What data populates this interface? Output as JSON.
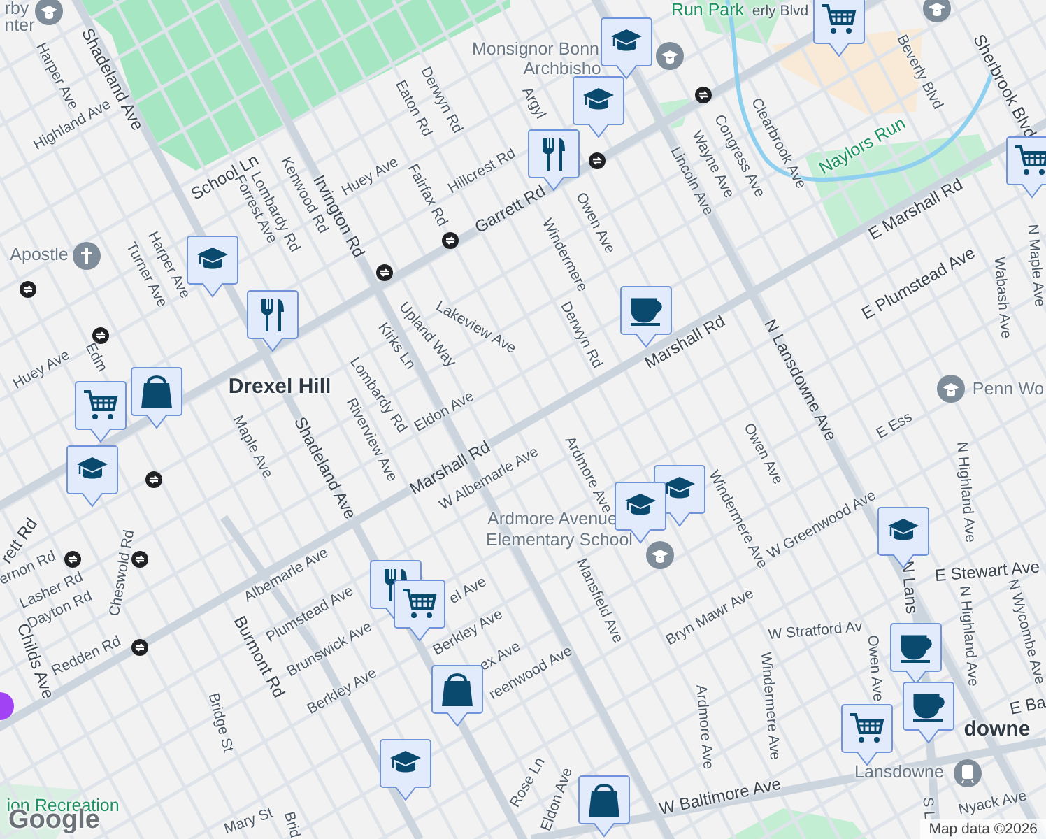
{
  "labels": [
    {
      "text": "rby",
      "kind": "poi"
    },
    {
      "text": "nter",
      "kind": "poi"
    },
    {
      "text": "Harper Ave",
      "kind": "street"
    },
    {
      "text": "Shadeland Ave",
      "kind": "major"
    },
    {
      "text": "Highland Ave",
      "kind": "street"
    },
    {
      "text": "Monsignor Bonn",
      "kind": "poi"
    },
    {
      "text": "Archbisho",
      "kind": "poi"
    },
    {
      "text": "Run Park",
      "kind": "park"
    },
    {
      "text": "erly Blvd",
      "kind": "street"
    },
    {
      "text": "Eaton Rd",
      "kind": "street"
    },
    {
      "text": "Derwyn Rd",
      "kind": "street"
    },
    {
      "text": "School Ln",
      "kind": "major"
    },
    {
      "text": "Forrest Ave",
      "kind": "street"
    },
    {
      "text": "Lombardy Rd",
      "kind": "street"
    },
    {
      "text": "Kenwood Rd",
      "kind": "street"
    },
    {
      "text": "Irvington Rd",
      "kind": "major"
    },
    {
      "text": "Huey Ave",
      "kind": "street"
    },
    {
      "text": "Fairfax Rd",
      "kind": "street"
    },
    {
      "text": "Hillcrest Rd",
      "kind": "street"
    },
    {
      "text": "Garrett Rd",
      "kind": "major"
    },
    {
      "text": "Argyl",
      "kind": "street"
    },
    {
      "text": "Owen Ave",
      "kind": "street"
    },
    {
      "text": "Windermere",
      "kind": "street"
    },
    {
      "text": "Lincoln Ave",
      "kind": "street"
    },
    {
      "text": "Wayne Ave",
      "kind": "street"
    },
    {
      "text": "Congress Ave",
      "kind": "street"
    },
    {
      "text": "Clearbrook Ave",
      "kind": "street"
    },
    {
      "text": "Beverly Blvd",
      "kind": "street"
    },
    {
      "text": "Sherbrook Blvd",
      "kind": "major"
    },
    {
      "text": "Naylors Run",
      "kind": "park"
    },
    {
      "text": "E Marshall Rd",
      "kind": "major"
    },
    {
      "text": "E Plumstead Ave",
      "kind": "major"
    },
    {
      "text": "Wabash Ave",
      "kind": "street"
    },
    {
      "text": "N Maple Ave",
      "kind": "street"
    },
    {
      "text": "Apostle",
      "kind": "poi"
    },
    {
      "text": "Turner Ave",
      "kind": "street"
    },
    {
      "text": "Harper Ave",
      "kind": "street"
    },
    {
      "text": "Lakeview Ave",
      "kind": "street"
    },
    {
      "text": "Upland Way",
      "kind": "street"
    },
    {
      "text": "Kirks Ln",
      "kind": "street"
    },
    {
      "text": "Lombardy Rd",
      "kind": "street"
    },
    {
      "text": "Eldon Ave",
      "kind": "street"
    },
    {
      "text": "Derwyn Rd",
      "kind": "street"
    },
    {
      "text": "Marshall Rd",
      "kind": "major"
    },
    {
      "text": "N Lansdowne Ave",
      "kind": "major"
    },
    {
      "text": "Penn Wo",
      "kind": "poi"
    },
    {
      "text": "Huey Ave",
      "kind": "street"
    },
    {
      "text": "Edm",
      "kind": "street"
    },
    {
      "text": "Drexel Hill",
      "kind": "place"
    },
    {
      "text": "Maple Ave",
      "kind": "street"
    },
    {
      "text": "Shadeland Ave",
      "kind": "major"
    },
    {
      "text": "Riverview Ave",
      "kind": "street"
    },
    {
      "text": "Marshall Rd",
      "kind": "major"
    },
    {
      "text": "W Albemarle Ave",
      "kind": "street"
    },
    {
      "text": "Ardmore Ave",
      "kind": "street"
    },
    {
      "text": "Owen Ave",
      "kind": "street"
    },
    {
      "text": "E Ess",
      "kind": "street"
    },
    {
      "text": "Ardmore Avenue",
      "kind": "poi"
    },
    {
      "text": "Elementary School",
      "kind": "poi"
    },
    {
      "text": "Windermere Ave",
      "kind": "street"
    },
    {
      "text": "W Greenwood Ave",
      "kind": "street"
    },
    {
      "text": "N Highland Ave",
      "kind": "street"
    },
    {
      "text": "E Stewart Ave",
      "kind": "major"
    },
    {
      "text": "N Lans",
      "kind": "major"
    },
    {
      "text": "N Wycombe Ave",
      "kind": "street"
    },
    {
      "text": "N Highland Ave",
      "kind": "street"
    },
    {
      "text": "Mansfield Ave",
      "kind": "street"
    },
    {
      "text": "Bryn Mawr Ave",
      "kind": "street"
    },
    {
      "text": "W Stratford Av",
      "kind": "street"
    },
    {
      "text": "Owen Ave",
      "kind": "street"
    },
    {
      "text": "Windermere Ave",
      "kind": "street"
    },
    {
      "text": "Ardmore Ave",
      "kind": "street"
    },
    {
      "text": "E Ba",
      "kind": "major"
    },
    {
      "text": "downe",
      "kind": "place"
    },
    {
      "text": "Lansdowne",
      "kind": "poi"
    },
    {
      "text": "W Baltimore Ave",
      "kind": "major"
    },
    {
      "text": "Nyack Ave",
      "kind": "street"
    },
    {
      "text": "S L",
      "kind": "street"
    },
    {
      "text": "Rose Ln",
      "kind": "street"
    },
    {
      "text": "Eldon Ave",
      "kind": "street"
    },
    {
      "text": "rett Rd",
      "kind": "major"
    },
    {
      "text": "ernon Rd",
      "kind": "street"
    },
    {
      "text": "Cheswold Rd",
      "kind": "street"
    },
    {
      "text": "Lasher Rd",
      "kind": "street"
    },
    {
      "text": "Dayton Rd",
      "kind": "street"
    },
    {
      "text": "Childs Ave",
      "kind": "major"
    },
    {
      "text": "Redden Rd",
      "kind": "street"
    },
    {
      "text": "Albemarle Ave",
      "kind": "street"
    },
    {
      "text": "Plumstead Ave",
      "kind": "street"
    },
    {
      "text": "Brunswick Ave",
      "kind": "street"
    },
    {
      "text": "Berkley Ave",
      "kind": "street"
    },
    {
      "text": "Burmont Rd",
      "kind": "major"
    },
    {
      "text": "el Ave",
      "kind": "street"
    },
    {
      "text": "Berkley Ave",
      "kind": "street"
    },
    {
      "text": "ex Ave",
      "kind": "street"
    },
    {
      "text": "reenwood Ave",
      "kind": "street"
    },
    {
      "text": "Bridge St",
      "kind": "street"
    },
    {
      "text": "Mary St",
      "kind": "street"
    },
    {
      "text": "Brid",
      "kind": "street"
    },
    {
      "text": "ion Recreation",
      "kind": "park"
    }
  ],
  "logo": "Google",
  "attribution": "Map data ©2026"
}
